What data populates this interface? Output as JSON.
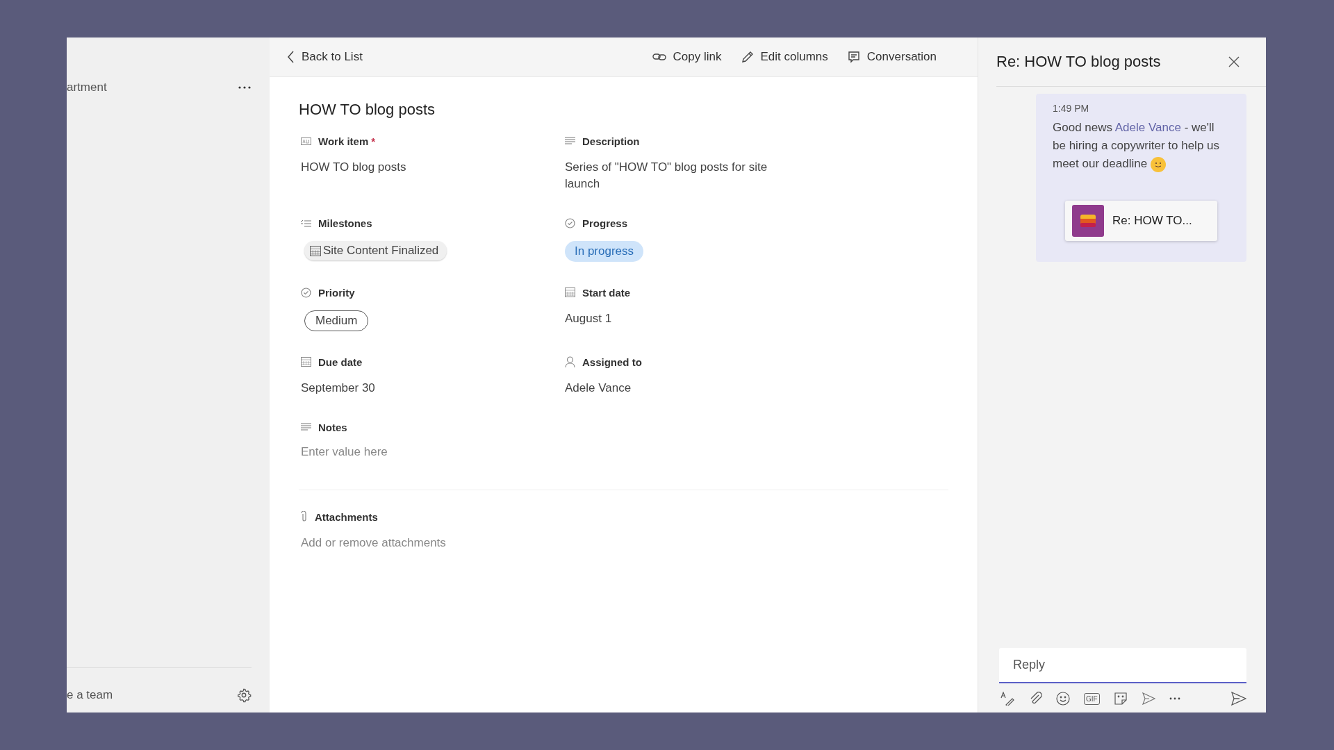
{
  "left_panel": {
    "team_name": "artment",
    "footer_text": "e a team"
  },
  "toolbar": {
    "back": "Back to List",
    "actions": [
      {
        "label": "Copy link"
      },
      {
        "label": "Edit columns"
      },
      {
        "label": "Conversation"
      }
    ]
  },
  "item": {
    "title": "HOW TO blog posts",
    "fields": [
      {
        "label": "Work item",
        "required_mark": "*",
        "kind": "text",
        "value": "HOW TO blog posts"
      },
      {
        "label": "Description",
        "kind": "text",
        "value": "Series of \"HOW TO\" blog posts for site launch"
      },
      {
        "label": "Milestones",
        "kind": "milestone",
        "value": "Site Content Finalized"
      },
      {
        "label": "Progress",
        "kind": "status",
        "value": "In progress"
      },
      {
        "label": "Priority",
        "kind": "choice",
        "value": "Medium"
      },
      {
        "label": "Start date",
        "kind": "text",
        "value": "August 1"
      },
      {
        "label": "Due date",
        "kind": "text",
        "value": "September 30"
      },
      {
        "label": "Assigned to",
        "kind": "text",
        "value": "Adele Vance"
      },
      {
        "label": "Notes",
        "kind": "placeholder",
        "placeholder": "Enter value here"
      }
    ]
  },
  "attachments": {
    "label": "Attachments",
    "placeholder": "Add or remove attachments"
  },
  "conversation": {
    "title": "Re: HOW TO blog posts",
    "message": {
      "time": "1:49 PM",
      "before": "Good news ",
      "mention": "Adele Vance",
      "after": " - we'll be hiring a copywriter to help us meet our deadline",
      "card": "Re: HOW TO..."
    },
    "reply": {
      "placeholder": "Reply"
    },
    "gif_label": "GIF"
  }
}
